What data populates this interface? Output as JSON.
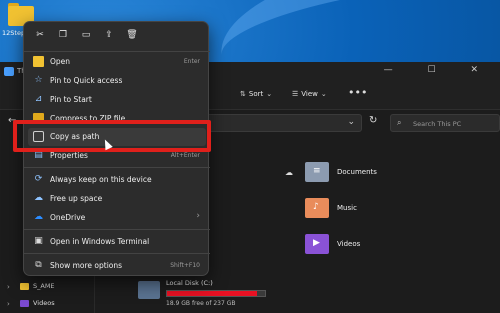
{
  "desktop": {
    "folder_label": "12Steps"
  },
  "explorer": {
    "window_title": "Th",
    "window_controls": "— ☐ ✕",
    "toolbar": {
      "sort_label": "Sort",
      "view_label": "View",
      "more_label": "•••"
    },
    "search_placeholder": "Search This PC",
    "nav": [
      {
        "label": "S_AME"
      },
      {
        "label": "Videos"
      }
    ],
    "libraries": [
      {
        "label": "Documents"
      },
      {
        "label": "Music"
      },
      {
        "label": "Videos"
      }
    ],
    "drive": {
      "name": "Local Disk (C:)",
      "free_text": "18.9 GB free of 237 GB",
      "used_fraction": 0.92
    }
  },
  "context_menu": {
    "quick_actions": [
      "cut-icon",
      "copy-icon",
      "rename-icon",
      "share-icon",
      "delete-icon"
    ],
    "items": [
      {
        "label": "Open",
        "shortcut": "Enter",
        "icon": "folder-icon"
      },
      {
        "label": "Pin to Quick access",
        "shortcut": "",
        "icon": "star-icon"
      },
      {
        "label": "Pin to Start",
        "shortcut": "",
        "icon": "pin-icon"
      },
      {
        "label": "Compress to ZIP file",
        "shortcut": "",
        "icon": "zip-icon"
      },
      {
        "label": "Copy as path",
        "shortcut": "",
        "icon": "copy-path-icon"
      },
      {
        "label": "Properties",
        "shortcut": "Alt+Enter",
        "icon": "properties-icon"
      },
      {
        "label": "Always keep on this device",
        "shortcut": "",
        "icon": "cloud-sync-icon"
      },
      {
        "label": "Free up space",
        "shortcut": "",
        "icon": "cloud-icon"
      },
      {
        "label": "OneDrive",
        "shortcut": "›",
        "icon": "onedrive-icon"
      },
      {
        "label": "Open in Windows Terminal",
        "shortcut": "",
        "icon": "terminal-icon"
      },
      {
        "label": "Show more options",
        "shortcut": "Shift+F10",
        "icon": "more-options-icon"
      }
    ]
  },
  "highlight_color": "#e0201b",
  "drive_fill_color": "#e81123"
}
